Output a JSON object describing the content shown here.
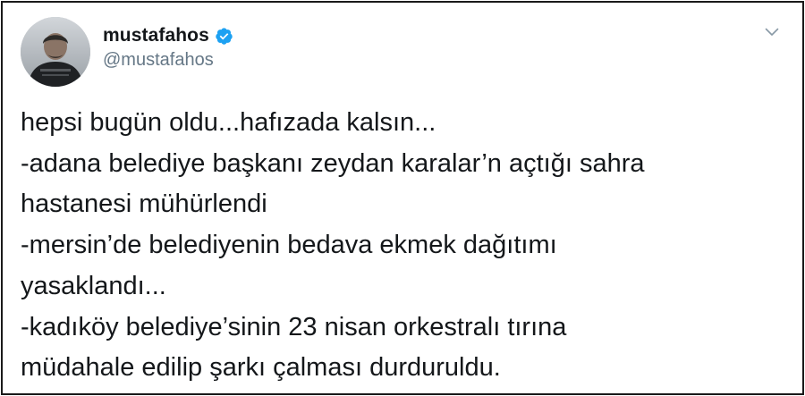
{
  "author": {
    "display_name": "mustafahos",
    "handle": "@mustafahos",
    "verified": true,
    "verified_color": "#1da1f2"
  },
  "tweet": {
    "lines": [
      "hepsi bugün oldu...hafızada kalsın...",
      "-adana belediye başkanı zeydan karalar’n açtığı sahra",
      "hastanesi mühürlendi",
      "-mersin’de belediyenin bedava ekmek dağıtımı",
      "yasaklandı...",
      "-kadıköy belediye’sinin 23 nisan orkestralı tırına",
      "müdahale edilip şarkı çalması durduruldu."
    ]
  },
  "icons": {
    "verified": "verified-badge-icon",
    "menu": "chevron-down-icon"
  }
}
